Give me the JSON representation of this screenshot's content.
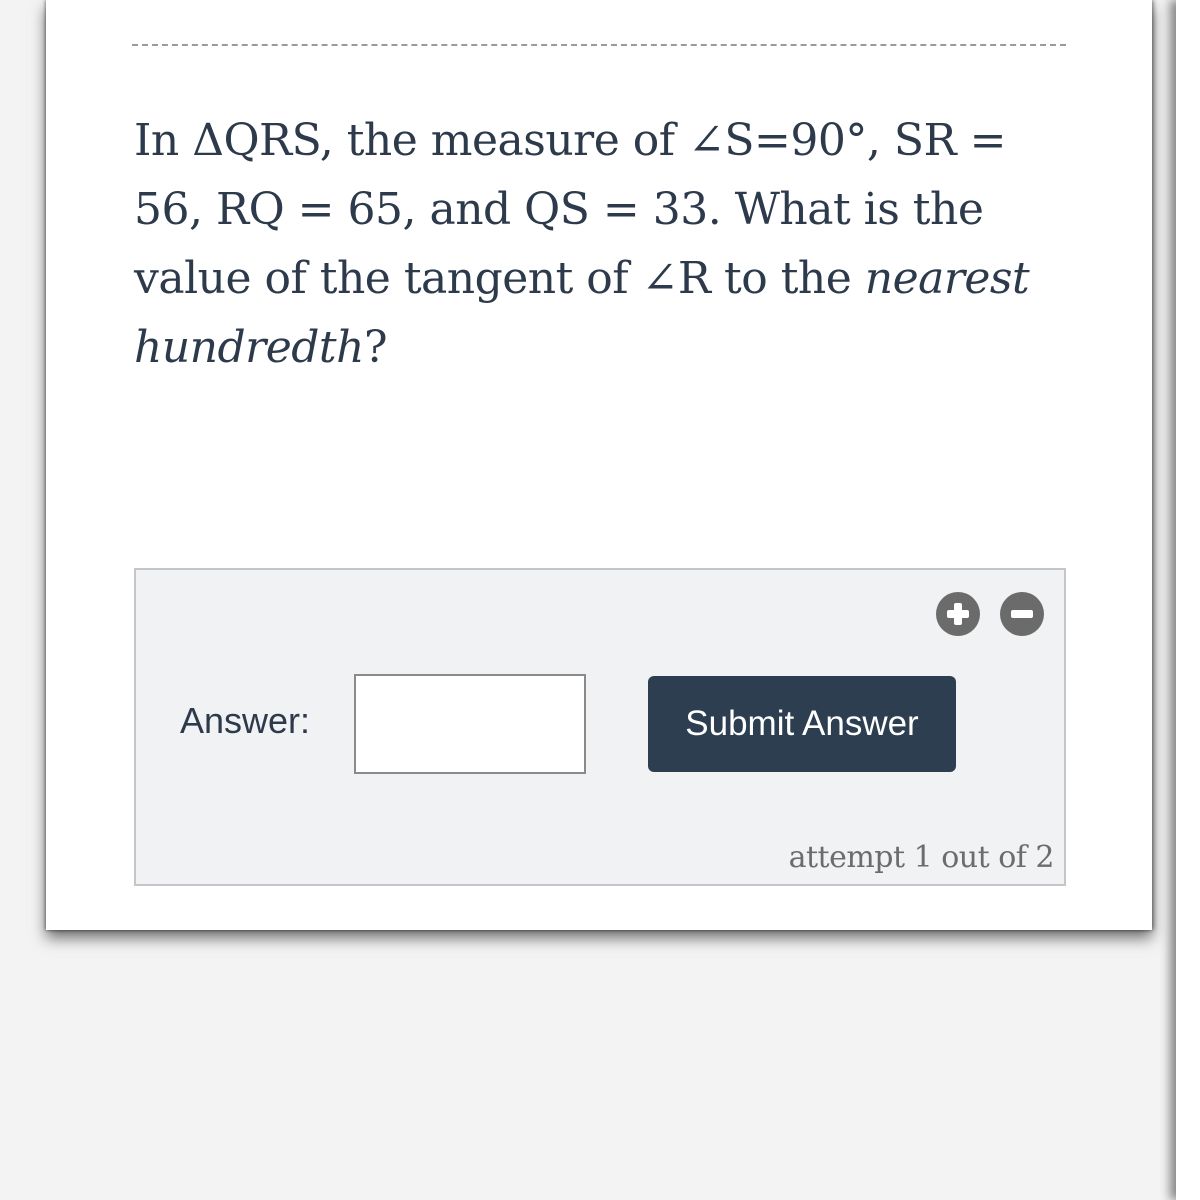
{
  "question": {
    "part1": "In ΔQRS, the measure of ∠S=90°, SR = 56, RQ = 65, and QS = 33. What is the value of the tangent of ∠R to the ",
    "emphasis1": "nearest hundredth",
    "part2": "?"
  },
  "answer_panel": {
    "label": "Answer:",
    "input_value": "",
    "submit_label": "Submit Answer",
    "attempt_text": "attempt 1 out of 2",
    "zoom_in_icon": "plus-circle-icon",
    "zoom_out_icon": "minus-circle-icon"
  },
  "colors": {
    "text": "#2d3a4b",
    "button": "#2c3e50",
    "icon": "#6b6b6b",
    "panel": "#f1f2f4"
  }
}
